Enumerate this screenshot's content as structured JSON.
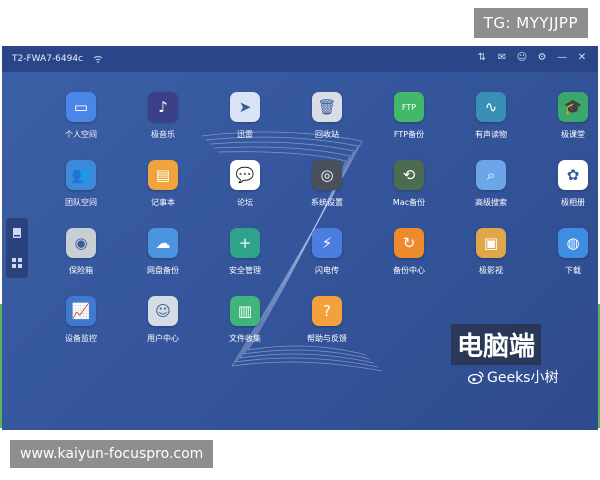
{
  "overlay": {
    "tg_label": "TG: MYYJJPP",
    "url_label": "www.kaiyun-focuspro.com"
  },
  "window": {
    "device_name": "T2-FWA7-6494c",
    "title_icons": [
      "sort-icon",
      "mail-icon",
      "user-icon",
      "gear-icon",
      "minimize-icon",
      "close-icon"
    ]
  },
  "sidebar": {
    "icons": [
      "storage-icon",
      "apps-icon"
    ]
  },
  "apps": [
    {
      "label": "个人空间",
      "icon": "folder-icon",
      "color": "#4a86e8"
    },
    {
      "label": "极音乐",
      "icon": "music-icon",
      "color": "#3b3f88"
    },
    {
      "label": "迅雷",
      "icon": "bird-icon",
      "color": "#d8e4f6"
    },
    {
      "label": "回收站",
      "icon": "trash-icon",
      "color": "#d9dee6"
    },
    {
      "label": "FTP备份",
      "icon": "ftp-icon",
      "color": "#43b86a"
    },
    {
      "label": "有声读物",
      "icon": "audio-icon",
      "color": "#3a8fb5"
    },
    {
      "label": "极课堂",
      "icon": "graduation-icon",
      "color": "#3aa86b"
    },
    {
      "label": "团队空间",
      "icon": "team-folder-icon",
      "color": "#3c8ad8"
    },
    {
      "label": "记事本",
      "icon": "notebook-icon",
      "color": "#f0a43c"
    },
    {
      "label": "论坛",
      "icon": "forum-icon",
      "color": "#ffffff"
    },
    {
      "label": "系统设置",
      "icon": "settings-icon",
      "color": "#4a4f5c"
    },
    {
      "label": "Mac备份",
      "icon": "time-machine-icon",
      "color": "#4c6b4f"
    },
    {
      "label": "高级搜索",
      "icon": "search-icon",
      "color": "#6aa6e8"
    },
    {
      "label": "极相册",
      "icon": "photos-icon",
      "color": "#ffffff"
    },
    {
      "label": "保险箱",
      "icon": "safe-icon",
      "color": "#c9cdd4"
    },
    {
      "label": "网盘备份",
      "icon": "cloud-backup-icon",
      "color": "#4b94e0"
    },
    {
      "label": "安全管理",
      "icon": "shield-icon",
      "color": "#2fa38a"
    },
    {
      "label": "闪电传",
      "icon": "flash-transfer-icon",
      "color": "#4b7ee0"
    },
    {
      "label": "备份中心",
      "icon": "backup-center-icon",
      "color": "#ef8a2c"
    },
    {
      "label": "极影视",
      "icon": "video-icon",
      "color": "#e0a64a"
    },
    {
      "label": "下载",
      "icon": "globe-download-icon",
      "color": "#3f8de0"
    },
    {
      "label": "设备监控",
      "icon": "monitor-chart-icon",
      "color": "#3f7ad0"
    },
    {
      "label": "用户中心",
      "icon": "user-center-icon",
      "color": "#d6dce6"
    },
    {
      "label": "文件收集",
      "icon": "file-collect-icon",
      "color": "#3fb47b"
    },
    {
      "label": "帮助与反馈",
      "icon": "help-icon",
      "color": "#f2a13c"
    }
  ],
  "watermark": {
    "title": "电脑端",
    "weibo": "Geeks小树"
  }
}
